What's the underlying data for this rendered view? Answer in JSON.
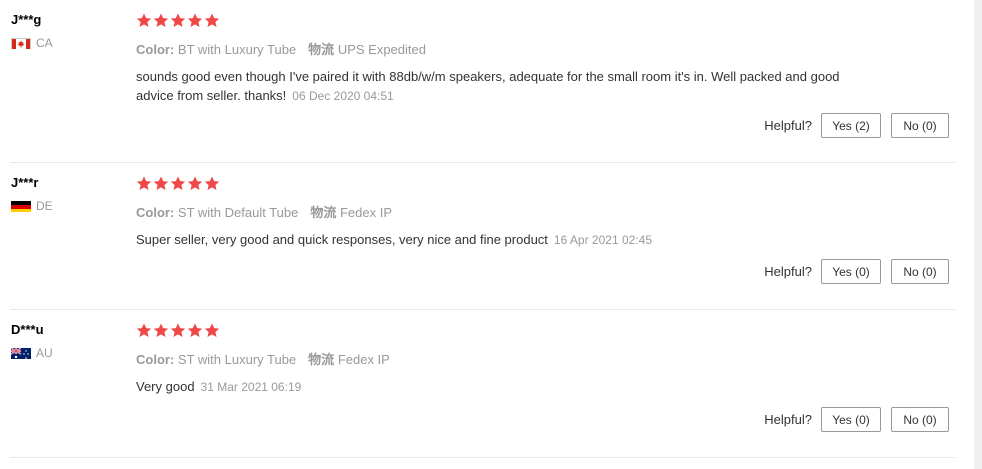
{
  "reviews": [
    {
      "user": "J***g",
      "country": "CA",
      "flag_icon": "canada-flag-icon",
      "rating": 5,
      "color_label": "Color:",
      "color_value": "BT with Luxury Tube",
      "logistics_label": "物流",
      "logistics_value": "UPS Expedited",
      "text": "sounds good even though I've paired it with 88db/w/m speakers, adequate for the small room it's in. Well packed and good advice from seller. thanks!",
      "date": "06 Dec 2020 04:51",
      "helpful_label": "Helpful?",
      "yes_label": "Yes (2)",
      "no_label": "No (0)"
    },
    {
      "user": "J***r",
      "country": "DE",
      "flag_icon": "germany-flag-icon",
      "rating": 5,
      "color_label": "Color:",
      "color_value": "ST with Default Tube",
      "logistics_label": "物流",
      "logistics_value": "Fedex IP",
      "text": "Super seller, very good and quick responses, very nice and fine product",
      "date": "16 Apr 2021 02:45",
      "helpful_label": "Helpful?",
      "yes_label": "Yes (0)",
      "no_label": "No (0)"
    },
    {
      "user": "D***u",
      "country": "AU",
      "flag_icon": "australia-flag-icon",
      "rating": 5,
      "color_label": "Color:",
      "color_value": "ST with Luxury Tube",
      "logistics_label": "物流",
      "logistics_value": "Fedex IP",
      "text": "Very good",
      "date": "31 Mar 2021 06:19",
      "helpful_label": "Helpful?",
      "yes_label": "Yes (0)",
      "no_label": "No (0)"
    }
  ],
  "colors": {
    "star": "#f04848",
    "muted_text": "#999999",
    "divider": "#e8e8e8"
  }
}
